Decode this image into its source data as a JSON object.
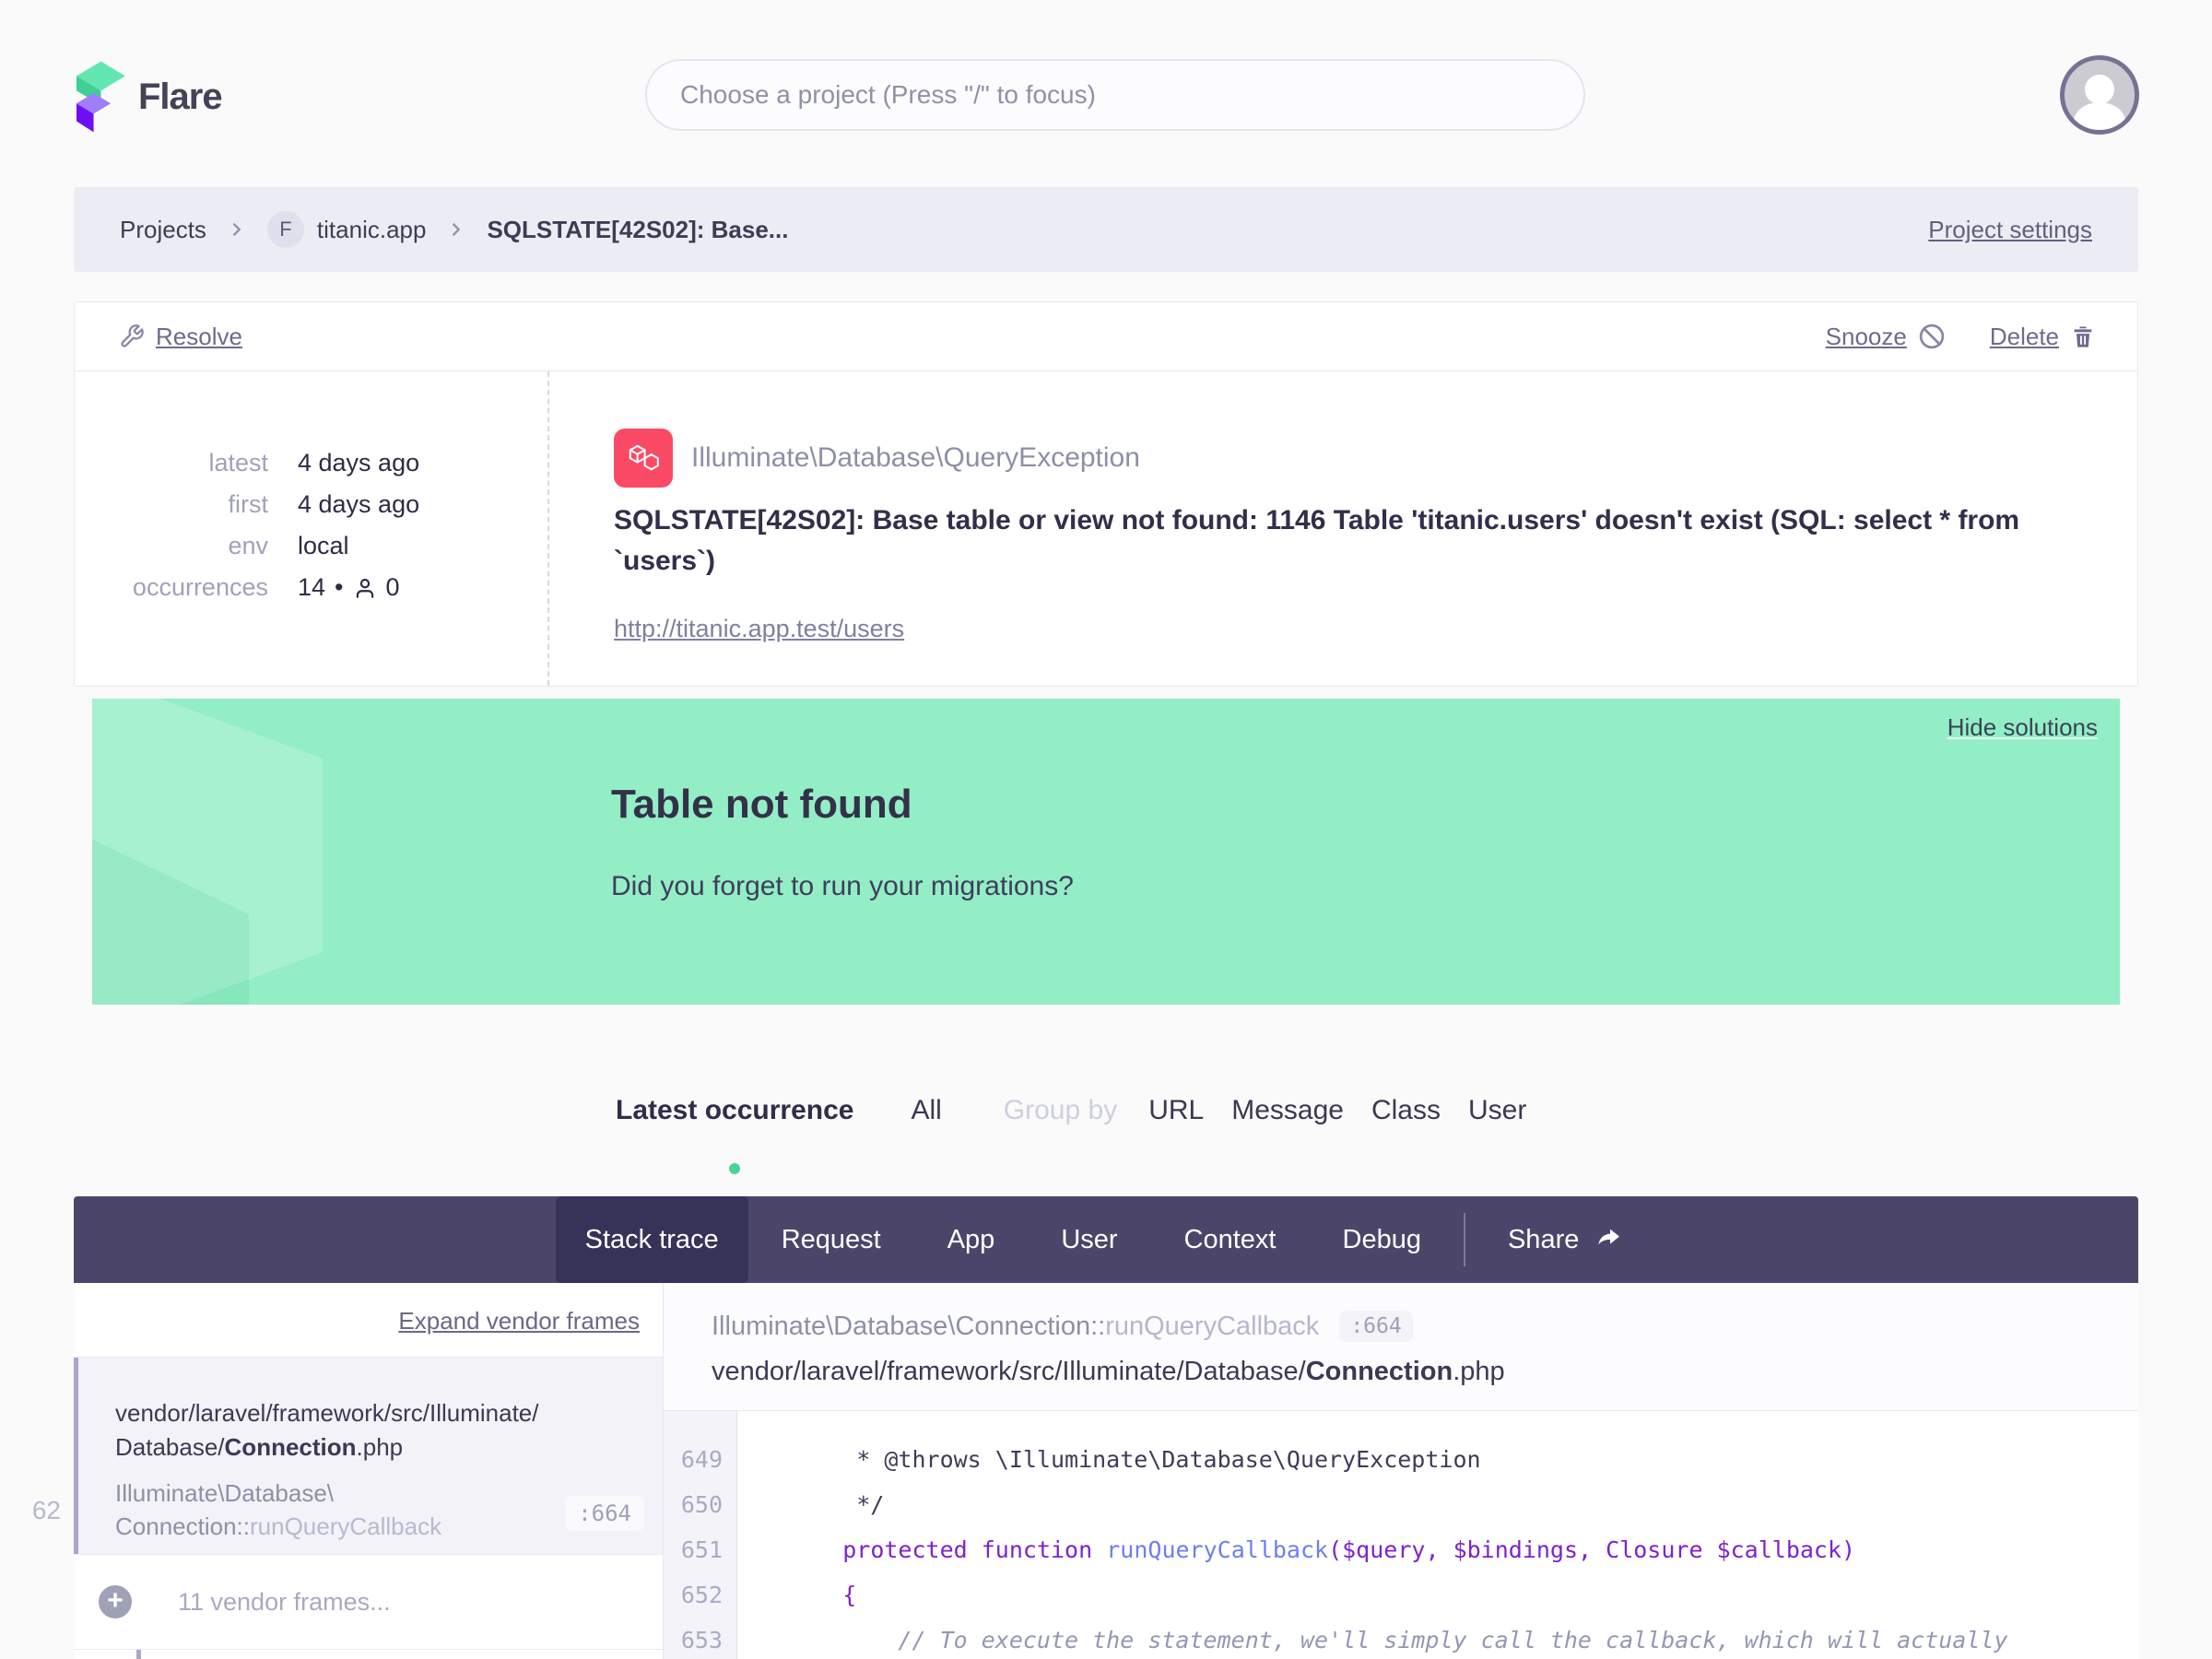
{
  "header": {
    "brand": "Flare",
    "search_placeholder": "Choose a project (Press \"/\" to focus)"
  },
  "breadcrumb": {
    "projects": "Projects",
    "badge": "F",
    "project": "titanic.app",
    "error_short": "SQLSTATE[42S02]: Base...",
    "settings": "Project settings"
  },
  "actions": {
    "resolve": "Resolve",
    "snooze": "Snooze",
    "delete": "Delete"
  },
  "error": {
    "stats": [
      {
        "label": "latest",
        "value": "4 days ago"
      },
      {
        "label": "first",
        "value": "4 days ago"
      },
      {
        "label": "env",
        "value": "local"
      },
      {
        "label": "occurrences",
        "count": "14",
        "sep": "•",
        "user_count": "0"
      }
    ],
    "class": "Illuminate\\Database\\QueryException",
    "message": "SQLSTATE[42S02]: Base table or view not found: 1146 Table 'titanic.users' doesn't exist (SQL: select * from `users`)",
    "url": "http://titanic.app.test/users"
  },
  "solution": {
    "hide": "Hide solutions",
    "title": "Table not found",
    "body": "Did you forget to run your migrations?"
  },
  "filters": {
    "latest": "Latest occurrence",
    "all": "All",
    "group_by": "Group by",
    "url": "URL",
    "message": "Message",
    "class": "Class",
    "user": "User"
  },
  "nav": {
    "stack_trace": "Stack trace",
    "request": "Request",
    "app": "App",
    "user": "User",
    "context": "Context",
    "debug": "Debug",
    "share": "Share"
  },
  "stack": {
    "expand": "Expand vendor frames",
    "frame": {
      "index": "62",
      "path_prefix": "vendor/laravel/framework/src/Illuminate/",
      "path_prefix2": "Database/",
      "file": "Connection",
      "ext": ".php",
      "class_l1": "Illuminate\\Database\\",
      "class_l2": "Connection::",
      "method": "runQueryCallback",
      "line": ":664"
    },
    "vendor_toggle": "11 vendor frames..."
  },
  "code": {
    "class_prefix": "Illuminate\\Database\\Connection::",
    "method": "runQueryCallback",
    "line": ":664",
    "path_prefix": "vendor/laravel/framework/src/Illuminate/Database/",
    "file": "Connection",
    "ext": ".php",
    "lines": [
      {
        "no": "649",
        "tokens": [
          [
            "plain",
            "     * @throws \\Illuminate\\Database\\QueryException"
          ]
        ]
      },
      {
        "no": "650",
        "tokens": [
          [
            "plain",
            "     */"
          ]
        ]
      },
      {
        "no": "651",
        "tokens": [
          [
            "plain",
            "    "
          ],
          [
            "kw",
            "protected"
          ],
          [
            "plain",
            " "
          ],
          [
            "kw",
            "function"
          ],
          [
            "plain",
            " "
          ],
          [
            "fn",
            "runQueryCallback"
          ],
          [
            "kw",
            "("
          ],
          [
            "var",
            "$query"
          ],
          [
            "kw",
            ","
          ],
          [
            "plain",
            " "
          ],
          [
            "var",
            "$bindings"
          ],
          [
            "kw",
            ","
          ],
          [
            "plain",
            " "
          ],
          [
            "cls",
            "Closure"
          ],
          [
            "plain",
            " "
          ],
          [
            "var",
            "$callback"
          ],
          [
            "kw",
            ")"
          ]
        ]
      },
      {
        "no": "652",
        "tokens": [
          [
            "plain",
            "    "
          ],
          [
            "kw",
            "{"
          ]
        ]
      },
      {
        "no": "653",
        "tokens": [
          [
            "comment",
            "        // To execute the statement, we'll simply call the callback, which will actually"
          ]
        ]
      }
    ]
  }
}
